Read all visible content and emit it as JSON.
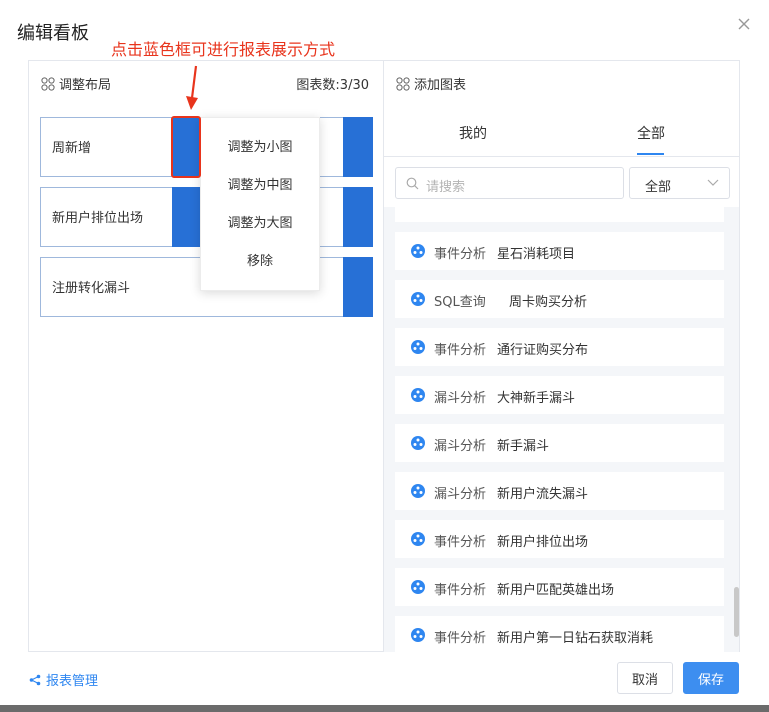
{
  "dialog": {
    "title": "编辑看板",
    "annotation": "点击蓝色框可进行报表展示方式"
  },
  "left_panel": {
    "heading": "调整布局",
    "count": "图表数:3/30",
    "items": [
      {
        "name": "周新增"
      },
      {
        "name": "新用户排位出场"
      },
      {
        "name": "注册转化漏斗"
      }
    ],
    "context_menu": [
      "调整为小图",
      "调整为中图",
      "调整为大图",
      "移除"
    ]
  },
  "right_panel": {
    "heading": "添加图表",
    "tabs": [
      {
        "label": "我的",
        "active": false
      },
      {
        "label": "全部",
        "active": true
      }
    ],
    "search_placeholder": "请搜索",
    "filter_value": "全部",
    "list": [
      {
        "type": "事件分析",
        "name": "星石消耗项目"
      },
      {
        "type": "SQL查询",
        "name": "周卡购买分析"
      },
      {
        "type": "事件分析",
        "name": "通行证购买分布"
      },
      {
        "type": "漏斗分析",
        "name": "大神新手漏斗"
      },
      {
        "type": "漏斗分析",
        "name": "新手漏斗"
      },
      {
        "type": "漏斗分析",
        "name": "新用户流失漏斗"
      },
      {
        "type": "事件分析",
        "name": "新用户排位出场"
      },
      {
        "type": "事件分析",
        "name": "新用户匹配英雄出场"
      },
      {
        "type": "事件分析",
        "name": "新用户第一日钻石获取消耗"
      }
    ]
  },
  "footer": {
    "manage_link": "报表管理",
    "cancel_label": "取消",
    "save_label": "保存"
  },
  "colors": {
    "accent": "#2e86f0",
    "bar_blue": "#2770d6",
    "annotation_red": "#e8341c"
  }
}
